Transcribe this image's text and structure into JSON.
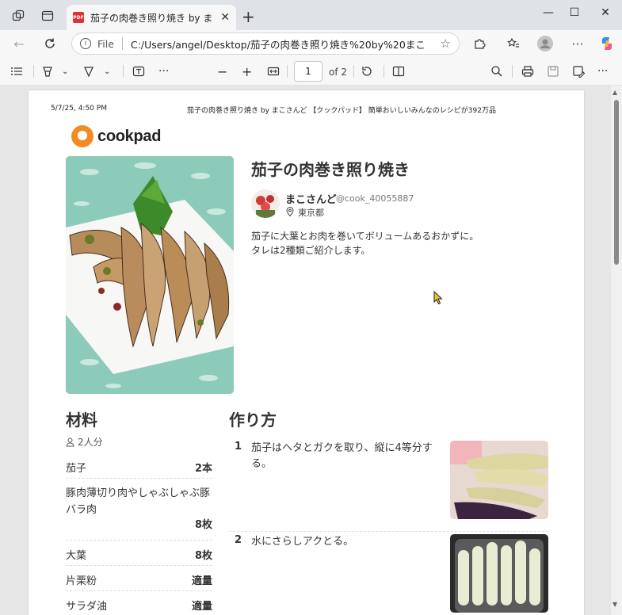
{
  "browser": {
    "tab_title": "茄子の肉巻き照り焼き by まこさんど",
    "address_label": "File",
    "url": "C:/Users/angel/Desktop/茄子の肉巻き照り焼き%20by%20まこさんど..."
  },
  "pdf_toolbar": {
    "page_number": "1",
    "page_of": "of 2"
  },
  "header": {
    "date": "5/7/25, 4:50 PM",
    "title": "茄子の肉巻き照り焼き by まこさんど 【クックパッド】 簡単おいしいみんなのレシピが392万品"
  },
  "brand": {
    "name": "cookpad",
    "accent": "#f48a25"
  },
  "recipe": {
    "title": "茄子の肉巻き照り焼き",
    "author_name": "まこさんど",
    "author_id": "@cook_40055887",
    "location": "東京都",
    "description_line1": "茄子に大葉とお肉を巻いてボリュームあるおかずに。",
    "description_line2": "タレは2種類ご紹介します。"
  },
  "ingredients": {
    "heading": "材料",
    "servings": "2人分",
    "items": [
      {
        "name": "茄子",
        "qty": "2本"
      },
      {
        "name": "豚肉薄切り肉やしゃぶしゃぶ豚バラ肉",
        "qty": "8枚"
      },
      {
        "name": "大葉",
        "qty": "8枚"
      },
      {
        "name": "片栗粉",
        "qty": "適量"
      },
      {
        "name": "サラダ油",
        "qty": "適量"
      }
    ]
  },
  "steps": {
    "heading": "作り方",
    "items": [
      {
        "num": "1",
        "text": "茄子はヘタとガクを取り、縦に4等分する。"
      },
      {
        "num": "2",
        "text": "水にさらしアクとる。"
      }
    ]
  }
}
